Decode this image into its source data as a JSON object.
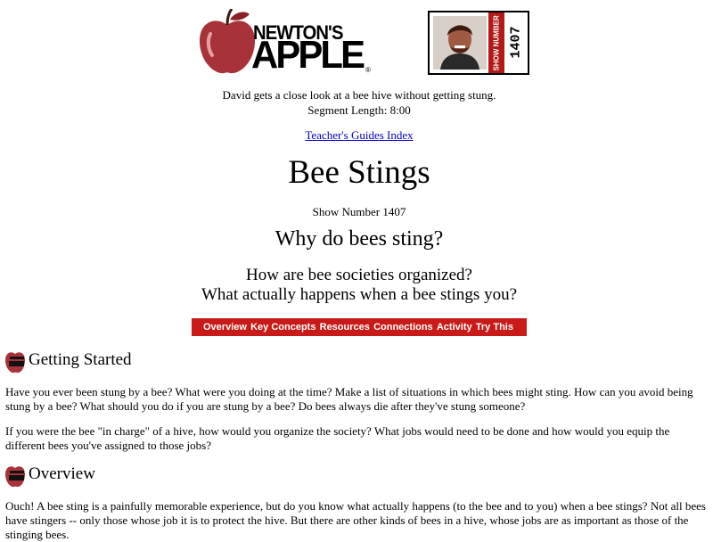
{
  "logo": {
    "line1": "NEWTON'S",
    "line2": "APPLE",
    "reg": "®"
  },
  "badge": {
    "label": "SHOW NUMBER",
    "number": "1407"
  },
  "description": {
    "line1": "David gets a close look at a bee hive without getting stung.",
    "line2": "Segment Length: 8:00"
  },
  "index_link": "Teacher's Guides Index",
  "title": "Bee Stings",
  "show_number": "Show Number 1407",
  "question_main": "Why do bees sting?",
  "questions": [
    "How are bee societies organized?",
    "What actually happens when a bee stings you?"
  ],
  "nav": [
    "Overview",
    "Key Concepts",
    "Resources",
    "Connections",
    "Activity",
    "Try This"
  ],
  "sections": [
    {
      "heading": "Getting Started",
      "paragraphs": [
        "Have you ever been stung by a bee? What were you doing at the time? Make a list of situations in which bees might sting. How can you avoid being stung by a bee? What should you do if you are stung by a bee? Do bees always die after they've stung someone?",
        "If you were the bee \"in charge\" of a hive, how would you organize the society? What jobs would need to be done and how would you equip the different bees you've assigned to those jobs?"
      ]
    },
    {
      "heading": "Overview",
      "paragraphs": [
        "Ouch! A bee sting is a painfully memorable experience, but do you know what actually happens (to the bee and to you) when a bee stings? Not all bees have stingers -- only those whose job it is to protect the hive. But there are other kinds of bees in a hive, whose jobs are as important as those of the stinging bees."
      ]
    }
  ],
  "colors": {
    "brand_red": "#c91a1a",
    "link_blue": "#0000cc"
  }
}
